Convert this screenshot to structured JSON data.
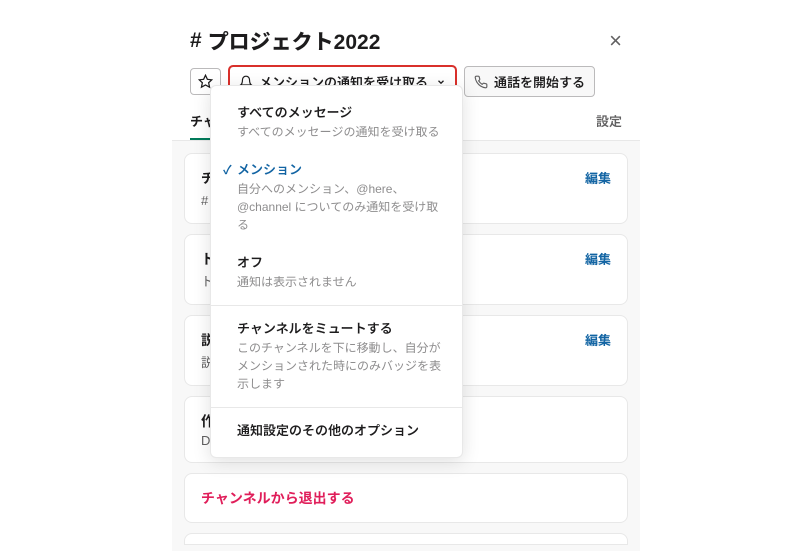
{
  "title": "プロジェクト2022",
  "toolbar": {
    "notification_label": "メンションの通知を受け取る",
    "call_label": "通話を開始する"
  },
  "tabs": {
    "channel_info": "チャン",
    "settings": "設定"
  },
  "rows": [
    {
      "title_prefix": "チャ",
      "sub_prefix": "# プ"
    },
    {
      "title_prefix": "トピ",
      "sub_prefix": "トピ"
    },
    {
      "title_prefix": "説明",
      "sub_prefix": "説明"
    },
    {
      "title_prefix": "作成",
      "sub_prefix": "Dr."
    }
  ],
  "edit_label": "編集",
  "leave_label": "チャンネルから退出する",
  "menu": {
    "all": {
      "title": "すべてのメッセージ",
      "desc": "すべてのメッセージの通知を受け取る"
    },
    "mention": {
      "title": "メンション",
      "desc": "自分へのメンション、@here、@channel についてのみ通知を受け取る"
    },
    "off": {
      "title": "オフ",
      "desc": "通知は表示されません"
    },
    "mute": {
      "title": "チャンネルをミュートする",
      "desc": "このチャンネルを下に移動し、自分がメンションされた時にのみバッジを表示します"
    },
    "more": {
      "title": "通知設定のその他のオプション"
    }
  }
}
